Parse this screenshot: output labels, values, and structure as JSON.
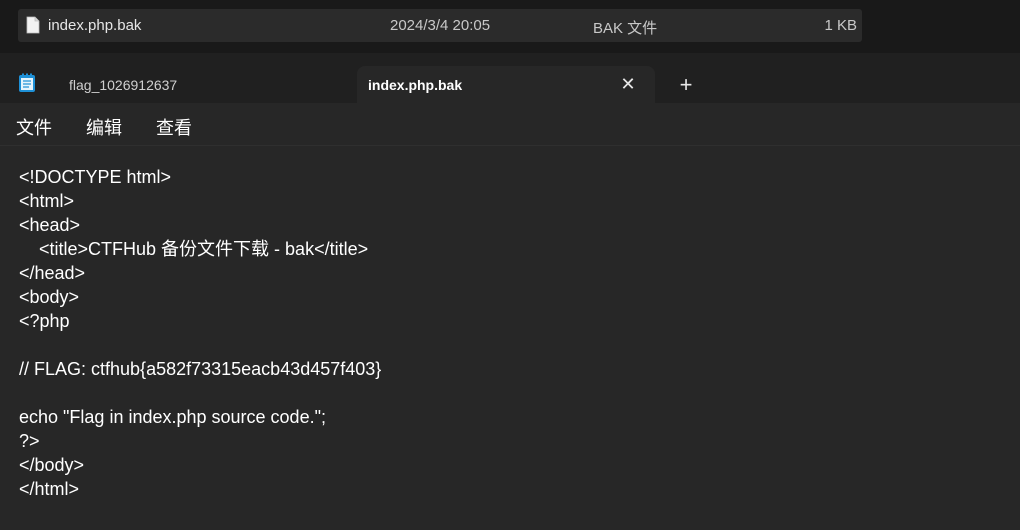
{
  "explorer": {
    "file": {
      "icon": "file-icon",
      "name": "index.php.bak",
      "date": "2024/3/4 20:05",
      "type": "BAK 文件",
      "size": "1 KB"
    }
  },
  "notepad": {
    "app_icon": "notepad-icon",
    "tabs": [
      {
        "label": "flag_1026912637"
      },
      {
        "label": "index.php.bak"
      }
    ],
    "close_symbol": "✕",
    "new_tab_symbol": "+",
    "menu": [
      "文件",
      "编辑",
      "查看"
    ],
    "lines": [
      "<!DOCTYPE html>",
      "<html>",
      "<head>",
      "    <title>CTFHub 备份文件下载 - bak</title>",
      "</head>",
      "<body>",
      "<?php",
      "",
      "// FLAG: ctfhub{a582f73315eacb43d457f403}",
      "",
      "echo \"Flag in index.php source code.\";",
      "?>",
      "</body>",
      "</html>"
    ]
  },
  "colors": {
    "background": "#272727",
    "titlebar": "#202020",
    "text": "#ffffff"
  }
}
